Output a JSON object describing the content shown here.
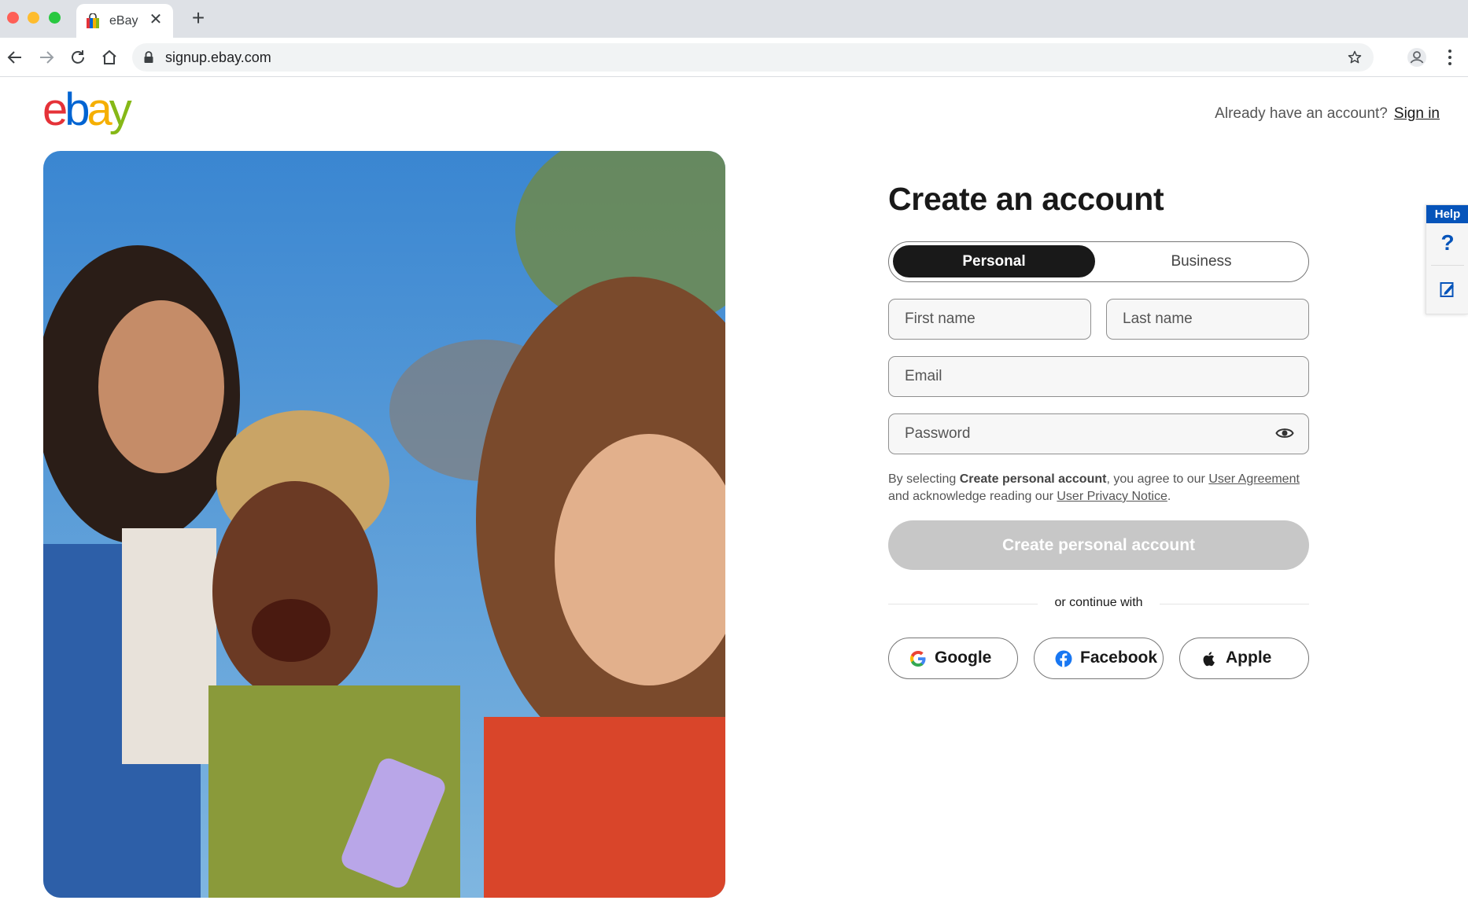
{
  "browser": {
    "tab_title": "eBay",
    "tab_close_glyph": "✕",
    "new_tab_glyph": "+",
    "url": "signup.ebay.com",
    "icons": [
      "back-arrow-icon",
      "forward-arrow-icon",
      "reload-icon",
      "home-icon",
      "lock-icon",
      "star-icon",
      "profile-icon",
      "kebab-menu-icon"
    ]
  },
  "header": {
    "logo_text": "ebay",
    "logo_colors": [
      "#e53238",
      "#0064d2",
      "#f5af02",
      "#86b817"
    ],
    "already_text": "Already have an account?",
    "signin_label": "Sign in"
  },
  "hero": {
    "icon": "photo-of-three-smiling-friends"
  },
  "form": {
    "heading": "Create an account",
    "account_types": {
      "selected": "Personal",
      "personal_label": "Personal",
      "business_label": "Business"
    },
    "fields": {
      "first_name_placeholder": "First name",
      "last_name_placeholder": "Last name",
      "email_placeholder": "Email",
      "password_placeholder": "Password"
    },
    "legal": {
      "prefix": "By selecting ",
      "bold": "Create personal account",
      "mid": ", you agree to our ",
      "agreement_link": "User Agreement",
      "mid2": " and acknowledge reading our ",
      "privacy_link": "User Privacy Notice",
      "suffix": "."
    },
    "submit_label": "Create personal account",
    "divider_text": "or continue with",
    "social": {
      "google_label": "Google",
      "facebook_label": "Facebook",
      "apple_label": "Apple"
    }
  },
  "help_widget": {
    "tab_label": "Help",
    "question_glyph": "?",
    "colors": {
      "accent": "#0654ba"
    }
  },
  "colors": {
    "primary_dark": "#191919",
    "disabled_button": "#c7c7c7",
    "facebook_blue": "#1877f2"
  }
}
